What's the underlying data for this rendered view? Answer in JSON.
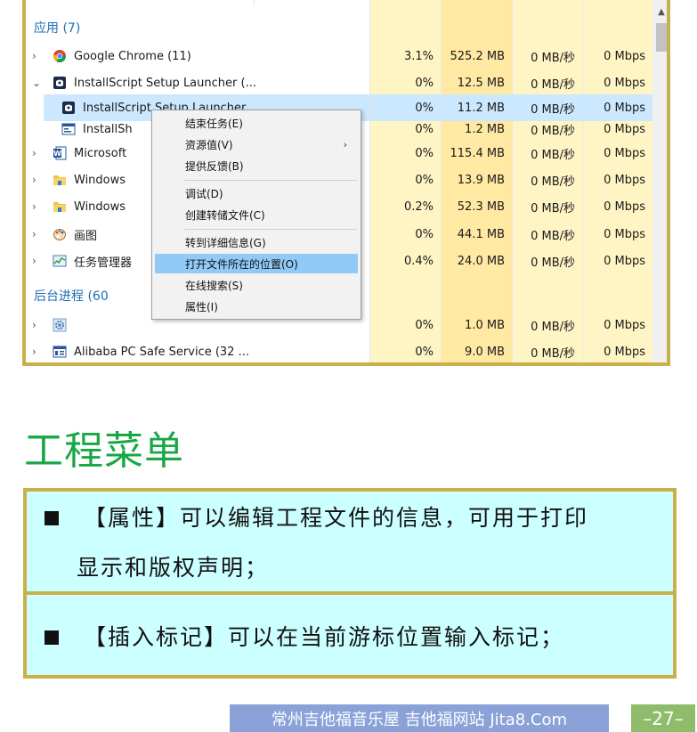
{
  "task_manager": {
    "rows": [
      {
        "type": "group",
        "title": "应用 (7)"
      },
      {
        "type": "proc",
        "chevron": "›",
        "icon": "chrome-icon",
        "name": "Google Chrome (11)",
        "cpu": "3.1%",
        "mem": "525.2 MB",
        "disk": "0 MB/秒",
        "net": "0 Mbps"
      },
      {
        "type": "proc",
        "chevron": "⌄",
        "icon": "installscript-icon",
        "name": "InstallScript Setup Launcher (...",
        "cpu": "0%",
        "mem": "12.5 MB",
        "disk": "0 MB/秒",
        "net": "0 Mbps"
      },
      {
        "type": "child",
        "selected": true,
        "icon": "installscript-icon",
        "name": "InstallScript Setup Launcher",
        "cpu": "0%",
        "mem": "11.2 MB",
        "disk": "0 MB/秒",
        "net": "0 Mbps"
      },
      {
        "type": "child",
        "icon": "window-icon",
        "name": "InstallSh",
        "cpu": "0%",
        "mem": "1.2 MB",
        "disk": "0 MB/秒",
        "net": "0 Mbps"
      },
      {
        "type": "proc",
        "chevron": "›",
        "icon": "word-icon",
        "name": "Microsoft",
        "cpu": "0%",
        "mem": "115.4 MB",
        "disk": "0 MB/秒",
        "net": "0 Mbps"
      },
      {
        "type": "proc",
        "chevron": "›",
        "icon": "folder-icon",
        "name": "Windows",
        "cpu": "0%",
        "mem": "13.9 MB",
        "disk": "0 MB/秒",
        "net": "0 Mbps"
      },
      {
        "type": "proc",
        "chevron": "›",
        "icon": "folder-icon",
        "name": "Windows",
        "cpu": "0.2%",
        "mem": "52.3 MB",
        "disk": "0 MB/秒",
        "net": "0 Mbps"
      },
      {
        "type": "proc",
        "chevron": "›",
        "icon": "paint-icon",
        "name": "画图",
        "cpu": "0%",
        "mem": "44.1 MB",
        "disk": "0 MB/秒",
        "net": "0 Mbps"
      },
      {
        "type": "proc",
        "chevron": "›",
        "icon": "taskmgr-icon",
        "name": "任务管理器",
        "cpu": "0.4%",
        "mem": "24.0 MB",
        "disk": "0 MB/秒",
        "net": "0 Mbps"
      },
      {
        "type": "group",
        "title": "后台进程 (60"
      },
      {
        "type": "proc",
        "chevron": "›",
        "icon": "gear-icon",
        "name": "",
        "cpu": "0%",
        "mem": "1.0 MB",
        "disk": "0 MB/秒",
        "net": "0 Mbps"
      },
      {
        "type": "proc",
        "chevron": "›",
        "icon": "service-icon",
        "name": "Alibaba PC Safe Service (32 ...",
        "cpu": "0%",
        "mem": "9.0 MB",
        "disk": "0 MB/秒",
        "net": "0 Mbps"
      }
    ],
    "colors": {
      "cpu_bg": "#fff4c4",
      "mem_bg": "#ffe9a3",
      "disk_bg": "#fff4c4",
      "net_bg": "#fff4c4",
      "selected": "#cce8ff",
      "group": "#1f6fb5"
    }
  },
  "context_menu": {
    "items": [
      {
        "label": "结束任务(E)"
      },
      {
        "label": "资源值(V)",
        "submenu": true
      },
      {
        "label": "提供反馈(B)"
      },
      {
        "label": "调试(D)"
      },
      {
        "label": "创建转储文件(C)"
      },
      {
        "label": "转到详细信息(G)"
      },
      {
        "label": "打开文件所在的位置(O)",
        "highlighted": true
      },
      {
        "label": "在线搜索(S)"
      },
      {
        "label": "属性(I)"
      }
    ]
  },
  "slide": {
    "heading": "工程菜单",
    "box1_line1": "【属性】可以编辑工程文件的信息，可用于打印",
    "box1_line2": "显示和版权声明；",
    "box2_line1": "【插入标记】可以在当前游标位置输入标记；"
  },
  "footer": {
    "text": "常州吉他福音乐屋 吉他福网站 Jita8.Com",
    "page": "–27–"
  }
}
